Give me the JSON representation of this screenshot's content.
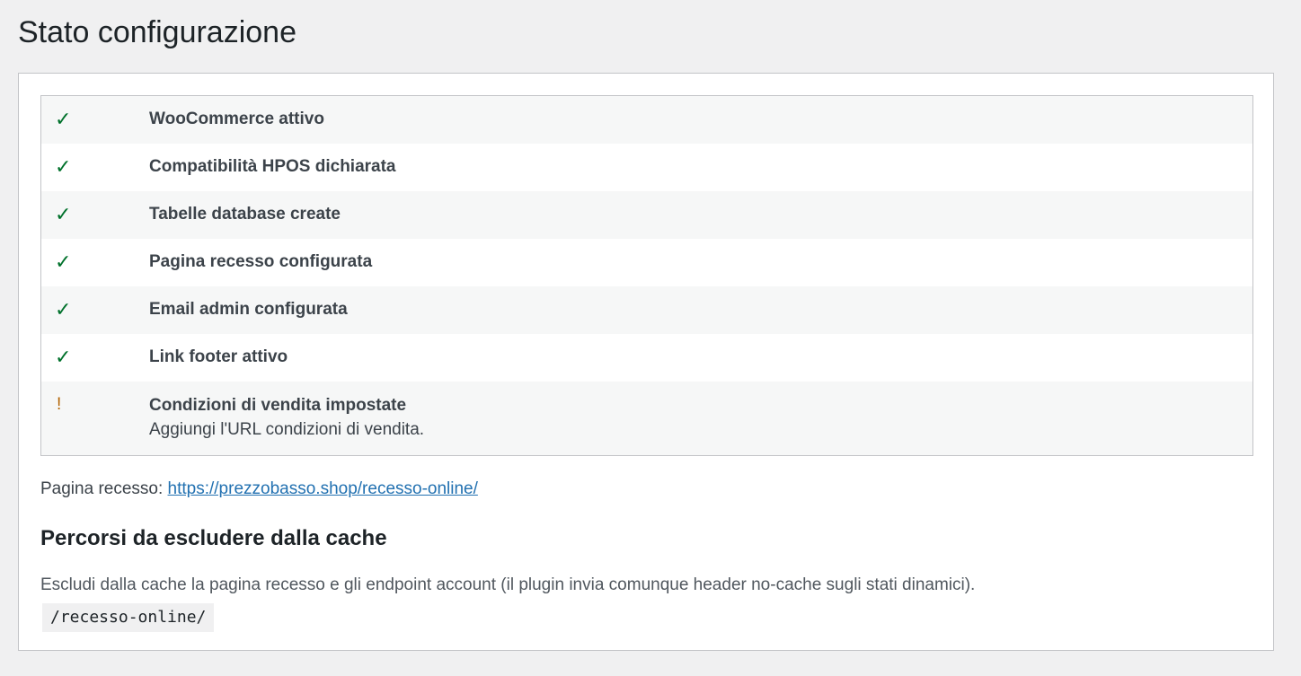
{
  "page": {
    "title": "Stato configurazione"
  },
  "checks": [
    {
      "status": "ok",
      "icon": "✓",
      "label": "WooCommerce attivo",
      "note": ""
    },
    {
      "status": "ok",
      "icon": "✓",
      "label": "Compatibilità HPOS dichiarata",
      "note": ""
    },
    {
      "status": "ok",
      "icon": "✓",
      "label": "Tabelle database create",
      "note": ""
    },
    {
      "status": "ok",
      "icon": "✓",
      "label": "Pagina recesso configurata",
      "note": ""
    },
    {
      "status": "ok",
      "icon": "✓",
      "label": "Email admin configurata",
      "note": ""
    },
    {
      "status": "ok",
      "icon": "✓",
      "label": "Link footer attivo",
      "note": ""
    },
    {
      "status": "warning",
      "icon": "!",
      "label": "Condizioni di vendita impostate",
      "note": "Aggiungi l'URL condizioni di vendita."
    }
  ],
  "recess_page": {
    "label": "Pagina recesso:",
    "url": "https://prezzobasso.shop/recesso-online/"
  },
  "cache_section": {
    "heading": "Percorsi da escludere dalla cache",
    "description": "Escludi dalla cache la pagina recesso e gli endpoint account (il plugin invia comunque header no-cache sugli stati dinamici).",
    "path": "/recesso-online/"
  },
  "colors": {
    "ok": "#00712b",
    "warning": "#b26200",
    "link": "#2271b1"
  }
}
